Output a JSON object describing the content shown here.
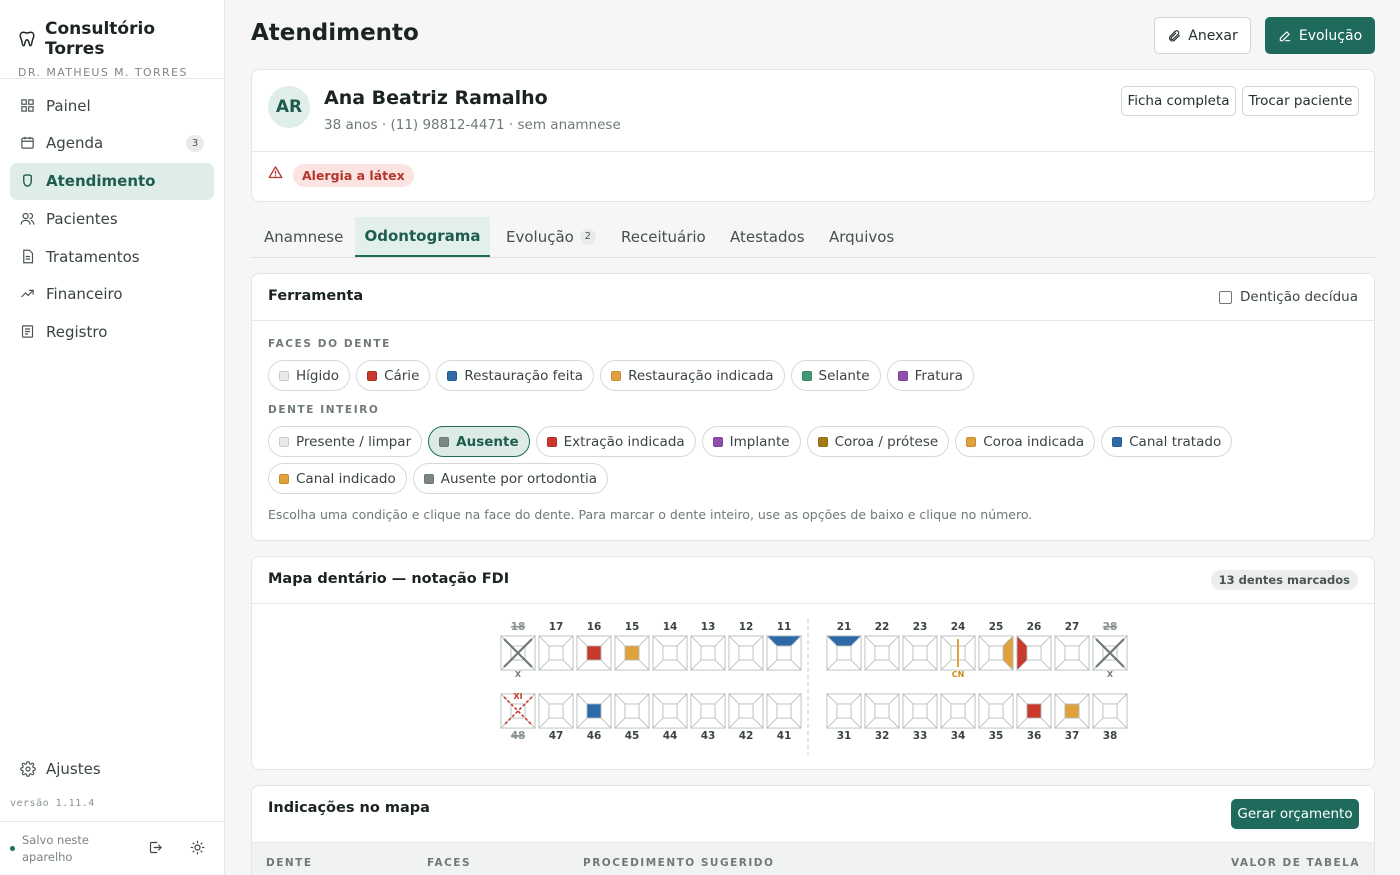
{
  "sidebar": {
    "brand_title": "Consultório Torres",
    "brand_subtitle": "DR. MATHEUS M. TORRES",
    "items": [
      {
        "label": "Painel",
        "icon": "grid-icon"
      },
      {
        "label": "Agenda",
        "icon": "calendar-icon",
        "count": "3"
      },
      {
        "label": "Atendimento",
        "icon": "tooth-icon",
        "active": true
      },
      {
        "label": "Pacientes",
        "icon": "users-icon"
      },
      {
        "label": "Tratamentos",
        "icon": "document-icon"
      },
      {
        "label": "Financeiro",
        "icon": "trend-icon"
      },
      {
        "label": "Registro",
        "icon": "log-icon"
      }
    ],
    "settings_label": "Ajustes",
    "version": "versão 1.11.4",
    "saved_text": "Salvo neste aparelho"
  },
  "header": {
    "title": "Atendimento",
    "attach_label": "Anexar",
    "evolution_label": "Evolução"
  },
  "patient": {
    "initials": "AR",
    "name": "Ana Beatriz Ramalho",
    "info": "38 anos · (11) 98812-4471 · sem anamnese",
    "full_record_label": "Ficha completa",
    "switch_label": "Trocar paciente",
    "allergy": "Alergia a látex"
  },
  "tabs": [
    {
      "label": "Anamnese"
    },
    {
      "label": "Odontograma",
      "active": true
    },
    {
      "label": "Evolução",
      "count": "2"
    },
    {
      "label": "Receituário"
    },
    {
      "label": "Atestados"
    },
    {
      "label": "Arquivos"
    }
  ],
  "tool": {
    "title": "Ferramenta",
    "deciduous_label": "Dentição decídua",
    "faces_label": "FACES DO DENTE",
    "faces": [
      {
        "label": "Hígido",
        "color": "#e8eae9"
      },
      {
        "label": "Cárie",
        "color": "#c8382c"
      },
      {
        "label": "Restauração feita",
        "color": "#2e6aa8"
      },
      {
        "label": "Restauração indicada",
        "color": "#e0a13c"
      },
      {
        "label": "Selante",
        "color": "#3f9a75"
      },
      {
        "label": "Fratura",
        "color": "#8e4fb0"
      }
    ],
    "whole_label": "DENTE INTEIRO",
    "whole": [
      {
        "label": "Presente / limpar",
        "color": "#e8eae9"
      },
      {
        "label": "Ausente",
        "color": "#7d8784",
        "selected": true
      },
      {
        "label": "Extração indicada",
        "color": "#c8382c"
      },
      {
        "label": "Implante",
        "color": "#8e4fb0"
      },
      {
        "label": "Coroa / prótese",
        "color": "#a57a12"
      },
      {
        "label": "Coroa indicada",
        "color": "#e0a13c"
      },
      {
        "label": "Canal tratado",
        "color": "#2e6aa8"
      },
      {
        "label": "Canal indicado",
        "color": "#e0a13c"
      },
      {
        "label": "Ausente por ortodontia",
        "color": "#7d8784"
      }
    ],
    "hint": "Escolha uma condição e clique na face do dente. Para marcar o dente inteiro, use as opções de baixo e clique no número."
  },
  "map": {
    "title": "Mapa dentário — notação FDI",
    "count_label": "13 dentes marcados",
    "upper_right": [
      "18",
      "17",
      "16",
      "15",
      "14",
      "13",
      "12",
      "11"
    ],
    "upper_left": [
      "21",
      "22",
      "23",
      "24",
      "25",
      "26",
      "27",
      "28"
    ],
    "lower_right": [
      "48",
      "47",
      "46",
      "45",
      "44",
      "43",
      "42",
      "41"
    ],
    "lower_left": [
      "31",
      "32",
      "33",
      "34",
      "35",
      "36",
      "37",
      "38"
    ],
    "marks": {
      "18": {
        "whole": "absent",
        "tag": "X"
      },
      "16": {
        "face": "center",
        "color": "#c8382c"
      },
      "15": {
        "face": "center",
        "color": "#e0a13c"
      },
      "11": {
        "face": "top",
        "color": "#2e6aa8"
      },
      "21": {
        "face": "top",
        "color": "#2e6aa8"
      },
      "24": {
        "whole": "canal",
        "color": "#e0a13c",
        "tag": "CN"
      },
      "25": {
        "face": "right",
        "color": "#e0a13c"
      },
      "26": {
        "face": "left",
        "color": "#c8382c"
      },
      "28": {
        "whole": "absent",
        "tag": "X"
      },
      "48": {
        "whole": "extraction",
        "tag": "XI"
      },
      "46": {
        "face": "center",
        "color": "#2e6aa8"
      },
      "36": {
        "face": "center",
        "color": "#c8382c"
      },
      "37": {
        "face": "center",
        "color": "#e0a13c"
      }
    }
  },
  "indications": {
    "title": "Indicações no mapa",
    "budget_label": "Gerar orçamento",
    "columns": [
      "DENTE",
      "FACES",
      "PROCEDIMENTO SUGERIDO",
      "VALOR DE TABELA"
    ]
  },
  "colors": {
    "accent": "#1e6b5d",
    "accent_light": "#deede8",
    "danger": "#c8382c"
  }
}
